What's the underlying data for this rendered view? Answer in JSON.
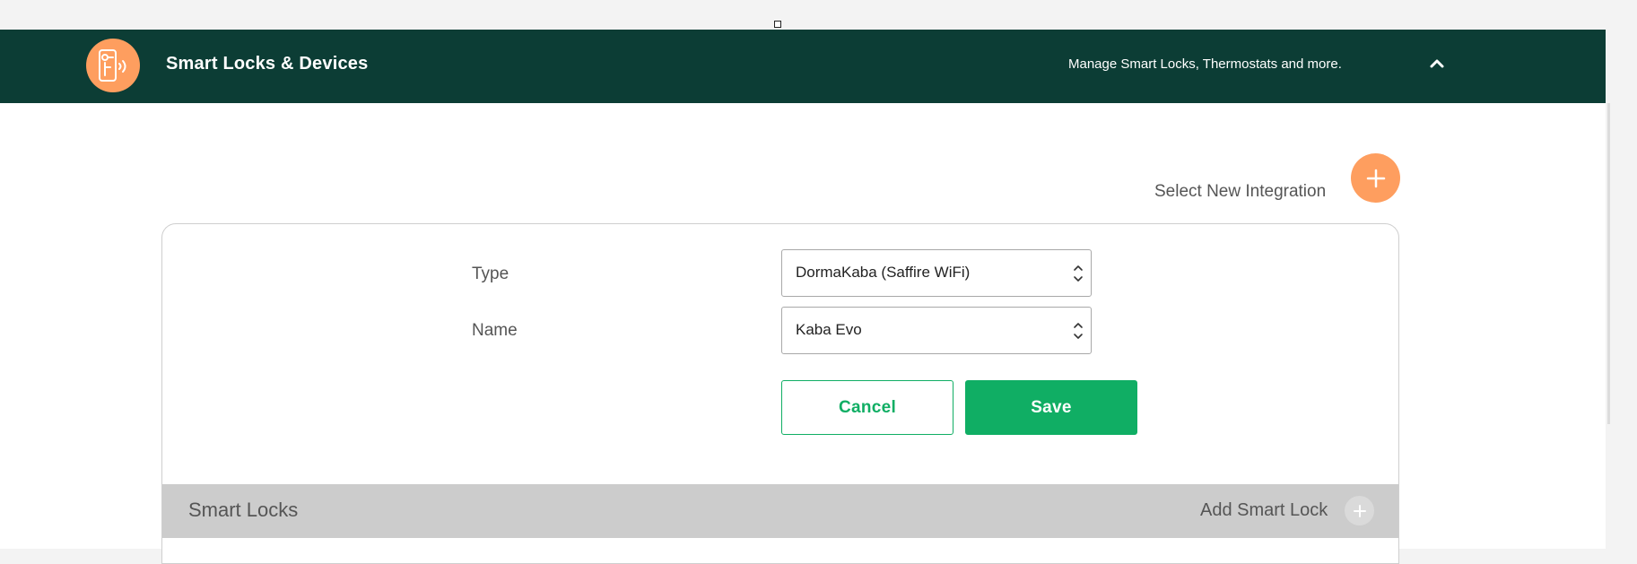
{
  "header": {
    "title": "Smart Locks & Devices",
    "subtitle": "Manage Smart Locks, Thermostats and more.",
    "icon": "smart-lock-icon",
    "collapse_icon": "chevron-up-icon",
    "accent_color": "#0c3d35",
    "icon_bg_color": "#fe9e5f"
  },
  "toolbar": {
    "select_new_integration_label": "Select New Integration",
    "add_icon": "plus-icon"
  },
  "form": {
    "type_label": "Type",
    "type_value": "DormaKaba (Saffire WiFi)",
    "name_label": "Name",
    "name_value": "Kaba Evo",
    "cancel_label": "Cancel",
    "save_label": "Save",
    "button_color": "#10ae64"
  },
  "section": {
    "title": "Smart Locks",
    "add_label": "Add Smart Lock",
    "add_icon": "plus-icon"
  }
}
